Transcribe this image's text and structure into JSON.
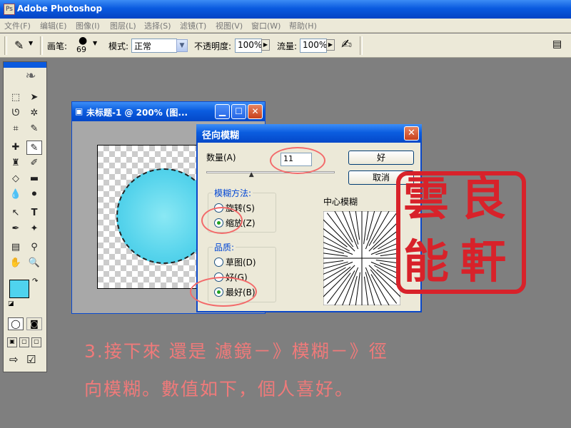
{
  "app": {
    "title": "Adobe Photoshop"
  },
  "menu": [
    "文件(F)",
    "编辑(E)",
    "图像(I)",
    "图层(L)",
    "选择(S)",
    "滤镜(T)",
    "视图(V)",
    "窗口(W)",
    "帮助(H)"
  ],
  "options": {
    "brush_label": "画笔:",
    "brush_size": "69",
    "mode_label": "模式:",
    "mode_value": "正常",
    "opacity_label": "不透明度:",
    "opacity_value": "100%",
    "flow_label": "流量:",
    "flow_value": "100%"
  },
  "document": {
    "title": "未标题-1 @ 200% (图..."
  },
  "dialog": {
    "title": "径向模糊",
    "amount_label": "数量(A)",
    "amount_value": "11",
    "amount_slider_fraction": 0.11,
    "ok_label": "好",
    "cancel_label": "取消",
    "method_group": "模糊方法:",
    "method_options": [
      "旋转(S)",
      "缩放(Z)"
    ],
    "method_selected": "缩放(Z)",
    "quality_group": "品质:",
    "quality_options": [
      "草图(D)",
      "好(G)",
      "最好(B)"
    ],
    "quality_selected": "最好(B)",
    "center_label": "中心模糊"
  },
  "caption": {
    "line1": "3.接下來 還是 濾鏡－》模糊－》徑",
    "line2": "向模糊。數值如下，個人喜好。"
  },
  "colors": {
    "highlight": "#f36a6a",
    "seal": "#d8222a",
    "foreground": "#4fd3ee",
    "background": "#ffffff"
  }
}
